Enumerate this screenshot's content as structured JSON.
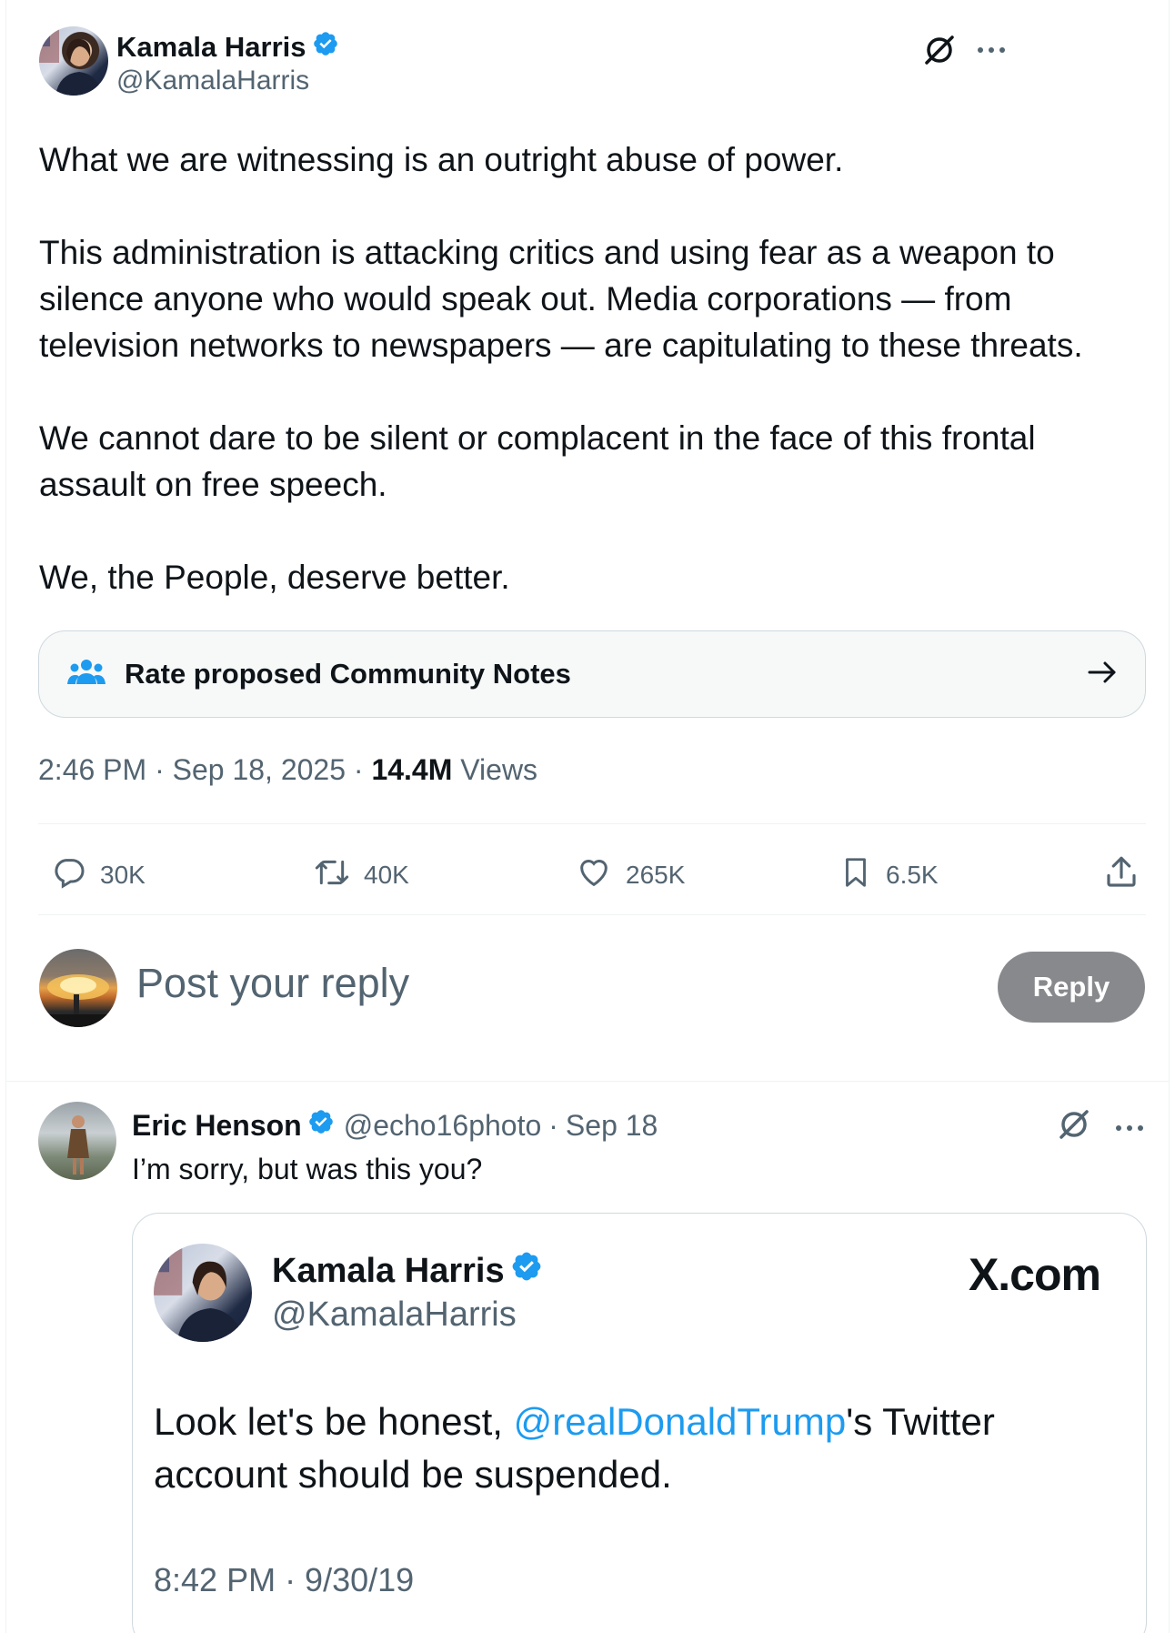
{
  "post": {
    "author_name": "Kamala Harris",
    "author_handle": "@KamalaHarris",
    "verified_icon": "verified-badge-icon",
    "paragraphs": [
      "What we are witnessing is an outright abuse of power.",
      "This administration is attacking critics and using fear as a weapon to silence anyone who would speak out. Media corporations — from television networks to newspapers — are capitulating to these threats.",
      "We cannot dare to be silent or complacent in the face of this frontal assault on free speech.",
      "We, the People, deserve better."
    ],
    "community_notes_label": "Rate proposed Community Notes",
    "time": "2:46 PM",
    "separator": "·",
    "date": "Sep 18, 2025",
    "views_count": "14.4M",
    "views_label": "Views",
    "stats": {
      "replies": "30K",
      "reposts": "40K",
      "likes": "265K",
      "bookmarks": "6.5K"
    }
  },
  "composer": {
    "placeholder": "Post your reply",
    "reply_button": "Reply"
  },
  "reply": {
    "author_name": "Eric Henson",
    "author_handle": "@echo16photo",
    "separator": "·",
    "date": "Sep 18",
    "text": "I’m sorry, but was this you?",
    "quoted": {
      "author_name": "Kamala Harris",
      "author_handle": "@KamalaHarris",
      "brand": "X.com",
      "text_before": "Look let's be honest, ",
      "mention": "@realDonaldTrump",
      "text_after": "'s Twitter account should be suspended.",
      "timestamp": "8:42 PM · 9/30/19"
    }
  },
  "colors": {
    "accent": "#1d9bf0",
    "text": "#0f1419",
    "secondary": "#536471",
    "border": "#cfd9de",
    "reply_button_bg": "#87898c"
  }
}
